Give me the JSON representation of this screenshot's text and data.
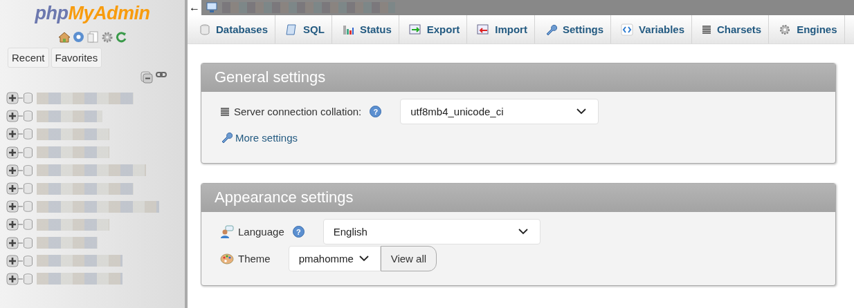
{
  "sidebar": {
    "logo_left": "php",
    "logo_right": "MyAdmin",
    "buttons": [
      {
        "label": "Recent"
      },
      {
        "label": "Favorites"
      }
    ],
    "databases": [
      {
        "expanded": false
      },
      {
        "expanded": false
      },
      {
        "expanded": false
      },
      {
        "expanded": false
      },
      {
        "expanded": false
      },
      {
        "expanded": false
      },
      {
        "expanded": false
      },
      {
        "expanded": false
      },
      {
        "expanded": false
      },
      {
        "expanded": false
      },
      {
        "expanded": false
      }
    ]
  },
  "topbar": {
    "back": "←"
  },
  "tabs": [
    {
      "label": "Databases",
      "selected": false
    },
    {
      "label": "SQL",
      "selected": false
    },
    {
      "label": "Status",
      "selected": false
    },
    {
      "label": "Export",
      "selected": false
    },
    {
      "label": "Import",
      "selected": false
    },
    {
      "label": "Settings",
      "selected": false
    },
    {
      "label": "Variables",
      "selected": false
    },
    {
      "label": "Charsets",
      "selected": false
    },
    {
      "label": "Engines",
      "selected": false
    }
  ],
  "panels": [
    {
      "title": "General settings",
      "rows": [
        {
          "kind": "select",
          "label": "Server connection collation:",
          "help": "?",
          "value": "utf8mb4_unicode_ci"
        },
        {
          "kind": "link",
          "label": "More settings"
        }
      ]
    },
    {
      "title": "Appearance settings",
      "rows": [
        {
          "kind": "select",
          "label": "Language",
          "help": "?",
          "value": "English"
        },
        {
          "kind": "theme",
          "label": "Theme",
          "value": "pmahomme",
          "button": "View all"
        }
      ]
    }
  ]
}
